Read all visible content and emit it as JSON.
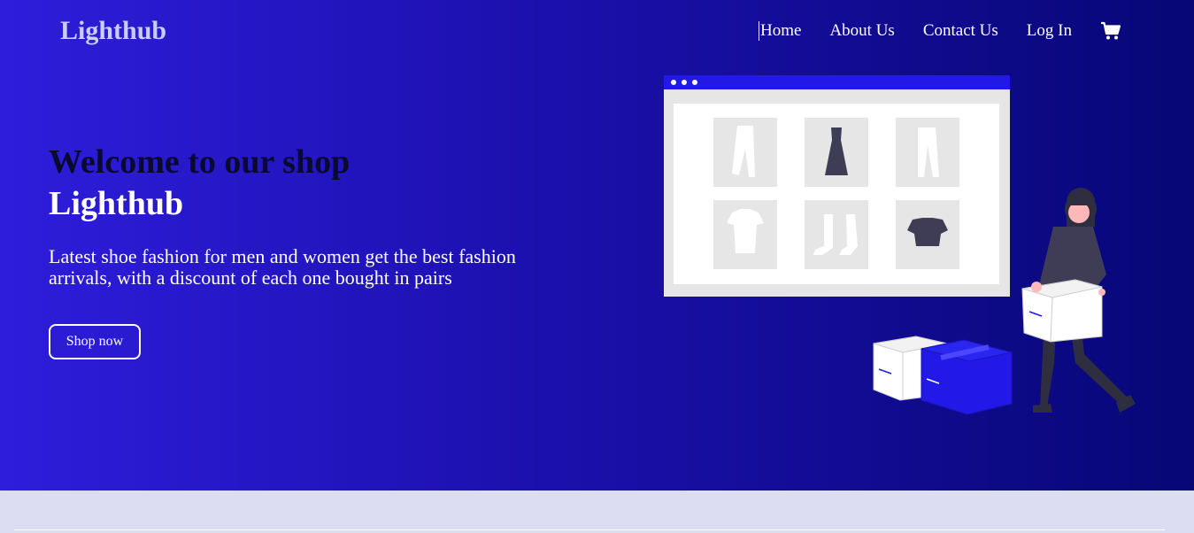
{
  "header": {
    "logo": "Lighthub",
    "nav": [
      "Home",
      "About Us",
      "Contact Us",
      "Log In"
    ],
    "cart_icon": "shopping-cart-icon"
  },
  "hero": {
    "headline": "Welcome to our shop",
    "brand": "Lighthub",
    "tagline": "Latest shoe fashion for men and women get the best fashion arrivals, with a discount of each one bought in pairs",
    "cta_label": "Shop now",
    "illustration": "online-shopping-illustration"
  },
  "colors": {
    "gradient_start": "#2e1ddb",
    "gradient_end": "#070776",
    "accent": "#2219e8",
    "page_bg": "#dcdcf2"
  }
}
